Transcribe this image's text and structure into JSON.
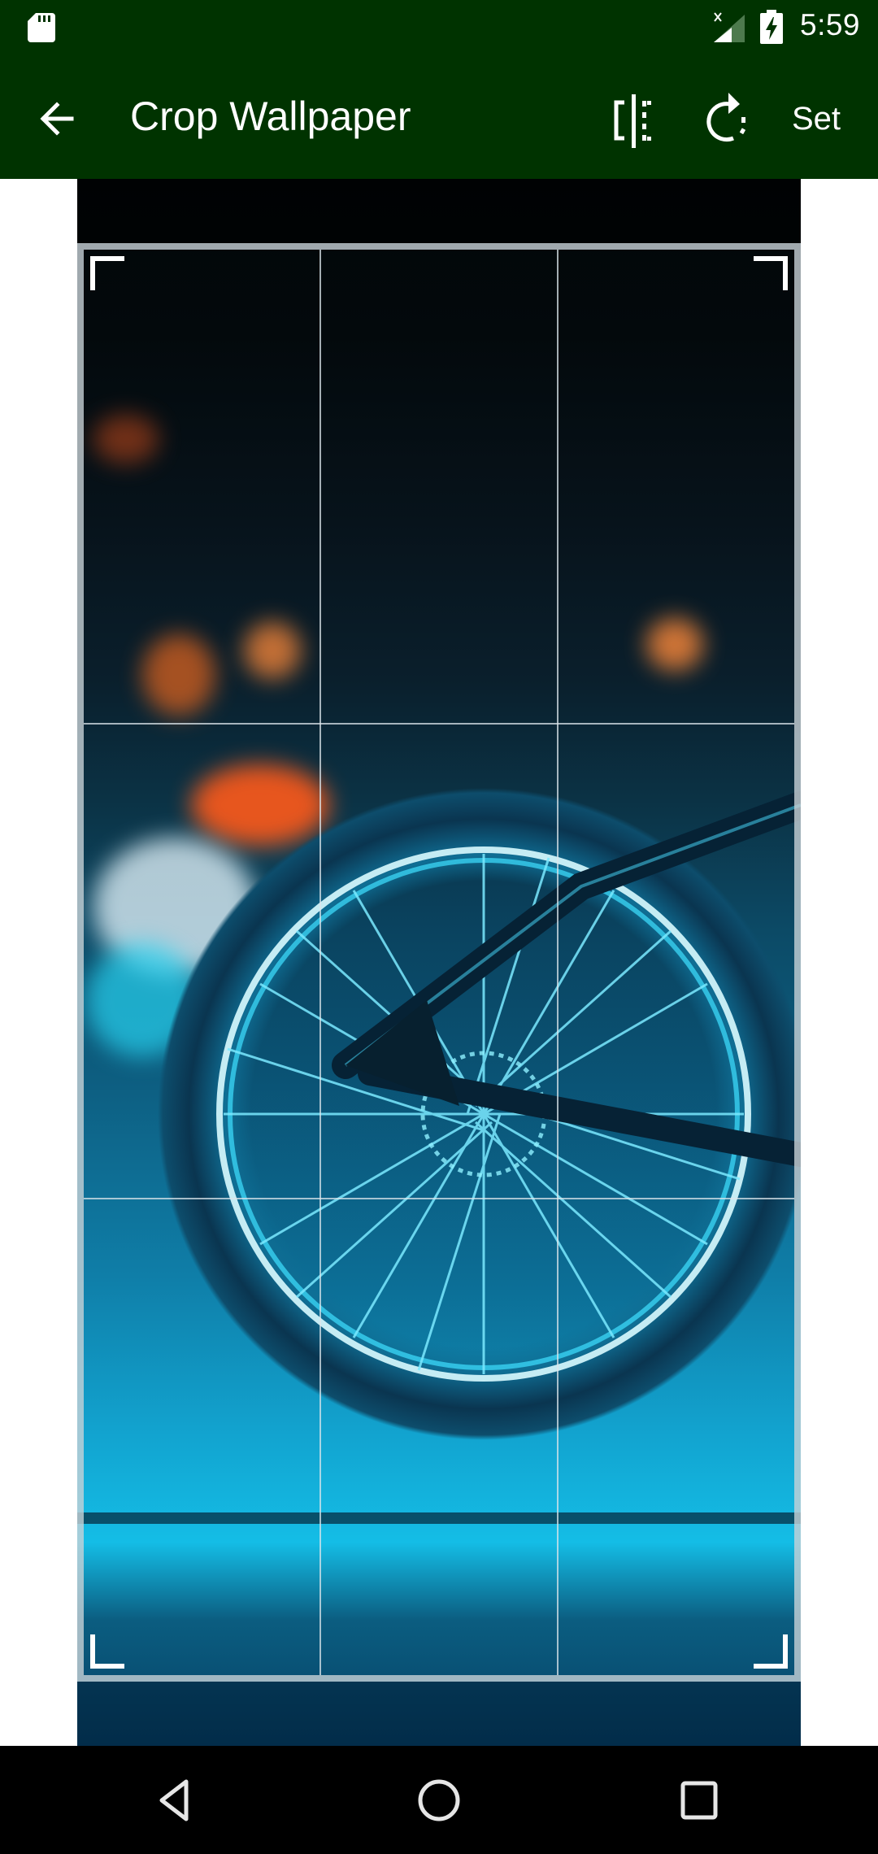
{
  "status_bar": {
    "time": "5:59",
    "icons": [
      "sd-card-icon",
      "signal-no-service-icon",
      "battery-charging-icon"
    ]
  },
  "toolbar": {
    "title": "Crop Wallpaper",
    "back_icon": "arrow-back-icon",
    "flip_icon": "flip-horizontal-icon",
    "rotate_icon": "rotate-clockwise-icon",
    "set_label": "Set"
  },
  "editor": {
    "image_description": "Neon-lit blue bicycle rear wheel with orange bokeh lights",
    "crop_grid": "rule-of-thirds"
  },
  "colors": {
    "toolbar_bg": "#003300",
    "status_bg": "#003300",
    "nav_bg": "#000000",
    "frame_border": "#c8d2d7",
    "accent_neon": "#14bde6",
    "bokeh_orange": "#ff7a1a"
  },
  "nav_bar": {
    "back": "nav-back-icon",
    "home": "nav-home-icon",
    "recents": "nav-recents-icon"
  }
}
